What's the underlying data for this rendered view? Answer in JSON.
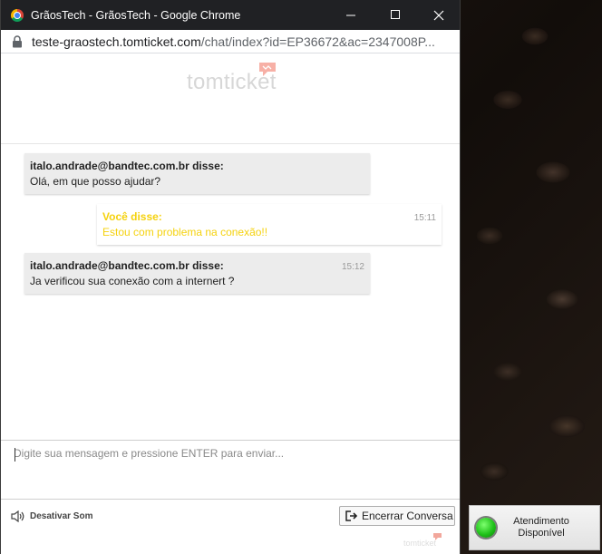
{
  "window": {
    "title": "GrãosTech - GrãosTech - Google Chrome",
    "controls": {
      "minimize": "–",
      "maximize": "☐",
      "close": "✕"
    }
  },
  "address_bar": {
    "domain": "teste-graostech.tomticket.com",
    "path": "/chat/index?id=EP36672&ac=2347008P..."
  },
  "logo": {
    "text": "tomticket"
  },
  "messages": [
    {
      "author": "italo.andrade@bandtec.com.br disse:",
      "body": "Olá, em que posso ajudar?",
      "time": ""
    },
    {
      "author": "Você disse:",
      "body": "Estou com problema na conexão!!",
      "time": "15:11"
    },
    {
      "author": "italo.andrade@bandtec.com.br disse:",
      "body": "Ja verificou sua conexão com a internert ?",
      "time": "15:12"
    }
  ],
  "composer": {
    "placeholder": "Digite sua mensagem e pressione ENTER para enviar..."
  },
  "footer": {
    "sound_label": "Desativar Som",
    "end_button_label": "Encerrar Conversa",
    "brand": "tomticket"
  },
  "status_widget": {
    "line1": "Atendimento",
    "line2": "Disponível",
    "status_color": "#20c21a"
  },
  "colors": {
    "own_message_text": "#f5d20e",
    "titlebar_bg": "#202124"
  }
}
